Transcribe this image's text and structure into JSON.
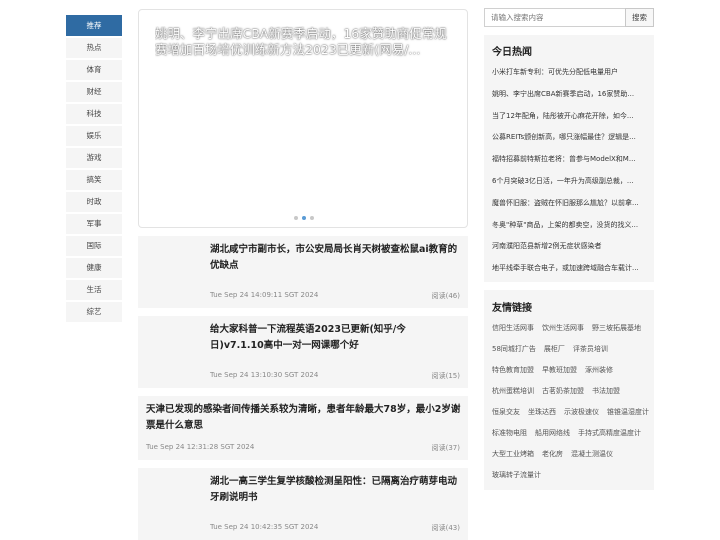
{
  "nav": {
    "items": [
      "推荐",
      "热点",
      "体育",
      "财经",
      "科技",
      "娱乐",
      "游戏",
      "搞笑",
      "时政",
      "军事",
      "国际",
      "健康",
      "生活",
      "综艺"
    ]
  },
  "carousel": {
    "title": "姚明、李宁出席CBA新赛季启动，16家赞助商促常规赛增加百场培优训练新方法2023已更新(网易/..."
  },
  "articles": [
    {
      "title": "湖北咸宁市副市长，市公安局局长肖天树被查松鼠ai教育的优缺点",
      "time": "Tue Sep 24 14:09:11 SGT 2024",
      "reads": "阅读(46)"
    },
    {
      "title": "给大家科普一下流程英语2023已更新(知乎/今日)v7.1.10高中一对一网课哪个好",
      "time": "Tue Sep 24 13:10:30 SGT 2024",
      "reads": "阅读(15)"
    },
    {
      "title": "天津已发现的感染者间传播关系较为清晰，患者年龄最大78岁，最小2岁谢票是什么意思",
      "time": "Tue Sep 24 12:31:28 SGT 2024",
      "reads": "阅读(37)"
    },
    {
      "title": "湖北一高三学生复学核酸检测呈阳性：已隔离治疗萌芽电动牙刷说明书",
      "time": "Tue Sep 24 10:42:35 SGT 2024",
      "reads": "阅读(43)"
    }
  ],
  "search": {
    "placeholder": "请输入搜索内容",
    "button": "搜索"
  },
  "hot": {
    "title": "今日热闻",
    "items": [
      "小米打车新专利：可优先分配低电量用户",
      "姚明、李宁出席CBA新赛季启动，16家赞助...",
      "当了12年配角，陆彤被开心麻花开除，如今...",
      "公募REITs颁创新高，哪只涨幅最佳？逻辑是...",
      "福特招募前特斯拉老将：曾参与ModelX和M...",
      "6个月突破3亿日活，一年升为高级副总裁，...",
      "魔兽怀旧服：盗贼在怀旧服那么尴尬？以前拿...",
      "冬奥\"种草\"商品，上架的都卖空，没货的找义...",
      "河南濮阳范县新增2例无症状感染者",
      "地平线牵手联合电子，或加速跨域融合车载计..."
    ]
  },
  "friends": {
    "title": "友情链接",
    "links": [
      "信阳生活网事",
      "饮州生活网事",
      "野三坡拓展基地",
      "58同城打广告",
      "展柜厂",
      "评茶员培训",
      "特色教育加盟",
      "早教班加盟",
      "涿州装修",
      "杭州蛋糕培训",
      "古茗奶茶加盟",
      "书法加盟",
      "恒泉交友",
      "坐珠达西",
      "示波极速仪",
      "锥锥温湿度计",
      "标准物电阻",
      "船用网络线",
      "手持式高精度温度计",
      "大型工业烤箱",
      "老化房",
      "混凝土测温仪",
      "玻璃转子流量计"
    ]
  }
}
